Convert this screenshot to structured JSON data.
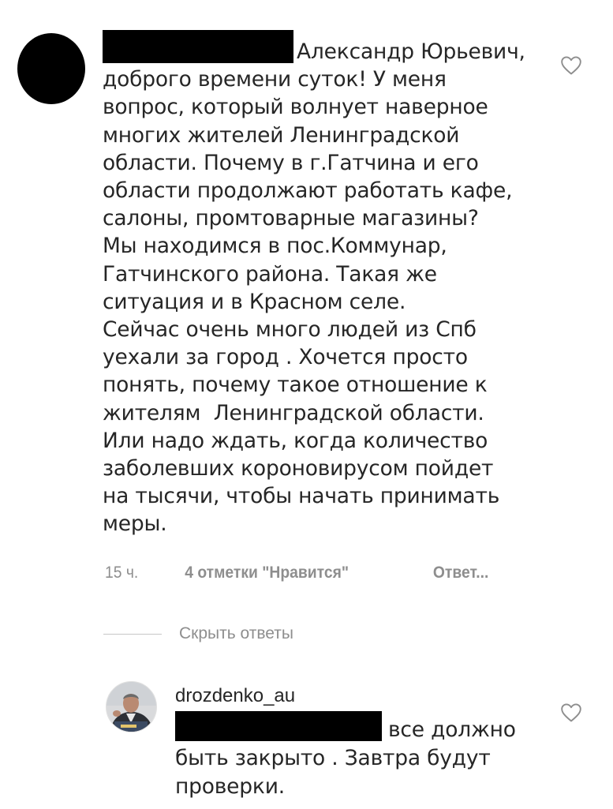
{
  "comment": {
    "lines": [
      "Александр Юрьевич,",
      "доброго времени суток! У меня",
      "вопрос, который волнует наверное",
      "многих жителей Ленинградской",
      "области. Почему в г.Гатчина и его",
      "области продолжают работать кафе,",
      "салоны, промтоварные магазины?",
      "Мы находимся в пос.Коммунар,",
      "Гатчинского района. Такая же",
      "ситуация и в Красном селе.",
      "Сейчас очень много людей из Спб",
      "уехали за город . Хочется просто",
      "понять, почему такое отношение к",
      "жителям  Ленинградской области.",
      "Или надо ждать, когда количество",
      "заболевших короновирусом пойдет",
      "на тысячи, чтобы начать принимать",
      "меры."
    ],
    "time": "15 ч.",
    "likes": "4 отметки \"Нравится\"",
    "reply": "Ответ..."
  },
  "hide_replies_label": "Скрыть ответы",
  "reply": {
    "username": "drozdenko_au",
    "lines": [
      "все должно",
      "быть закрыто . Завтра будут",
      "проверки."
    ]
  },
  "icons": {
    "like_icon": "heart-outline-icon",
    "avatar_redacted": "avatar-icon",
    "reply_avatar": "avatar-photo-icon"
  },
  "colors": {
    "text": "#262626",
    "secondary": "#8e8e8e",
    "divider": "#c7c7c7"
  }
}
